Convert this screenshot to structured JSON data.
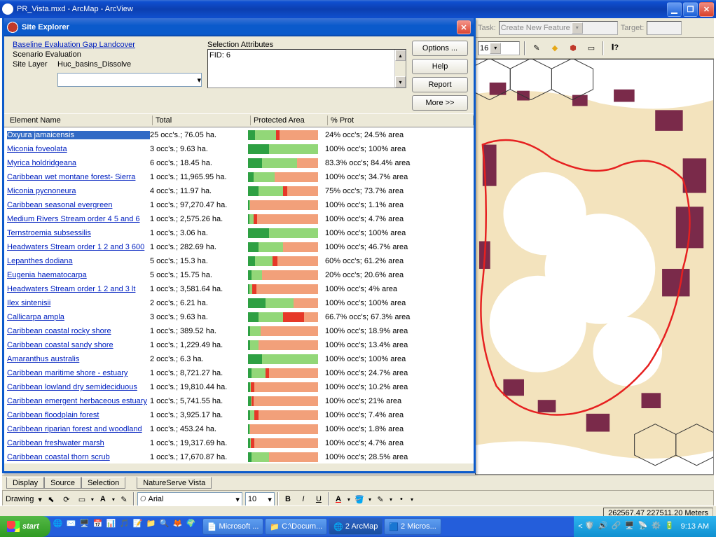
{
  "window": {
    "title": "PR_Vista.mxd - ArcMap - ArcView"
  },
  "toprow": {
    "task_label": "Task:",
    "task_value": "Create New Feature",
    "target_label": "Target:"
  },
  "secondrow": {
    "size_value": "16"
  },
  "dialog": {
    "title": "Site Explorer",
    "link1": "Baseline Evaluation Gap Landcover",
    "scenario": "Scenario Evaluation",
    "sitelayer_label": "Site Layer",
    "sitelayer_value": "Huc_basins_Dissolve",
    "attr_label": "Selection Attributes",
    "attr_text": "FID:  6",
    "btn_options": "Options ...",
    "btn_help": "Help",
    "btn_report": "Report",
    "btn_more": "More >>",
    "cols": {
      "name": "Element Name",
      "total": "Total",
      "pa": "Protected Area",
      "prot": "% Prot"
    },
    "rows": [
      {
        "name": "Oxyura jamaicensis",
        "total": "25 occ's.; 76.05 ha.",
        "prot": "24% occ's; 24.5% area",
        "sel": true,
        "bar": [
          10,
          30,
          5,
          55
        ]
      },
      {
        "name": "Miconia foveolata",
        "total": "3 occ's.; 9.63 ha.",
        "prot": "100% occ's; 100% area",
        "bar": [
          30,
          70,
          0,
          0
        ]
      },
      {
        "name": "Myrica holdridgeana",
        "total": "6 occ's.; 18.45 ha.",
        "prot": "83.3% occ's; 84.4% area",
        "bar": [
          20,
          50,
          0,
          30
        ]
      },
      {
        "name": "Caribbean wet montane forest- Sierra",
        "total": "1 occ's.; 11,965.95 ha.",
        "prot": "100% occ's; 34.7% area",
        "bar": [
          8,
          30,
          0,
          62
        ]
      },
      {
        "name": "Miconia pycnoneura",
        "total": "4 occ's.; 11.97 ha.",
        "prot": "75% occ's; 73.7% area",
        "bar": [
          15,
          35,
          6,
          44
        ]
      },
      {
        "name": "Caribbean seasonal evergreen",
        "total": "1 occ's.; 97,270.47 ha.",
        "prot": "100% occ's; 1.1% area",
        "bar": [
          2,
          1,
          0,
          97
        ]
      },
      {
        "name": "Medium Rivers Stream order 4 5 and 6",
        "total": "1 occ's.; 2,575.26 ha.",
        "prot": "100% occ's; 4.7% area",
        "bar": [
          2,
          6,
          5,
          87
        ]
      },
      {
        "name": "Ternstroemia subsessilis",
        "total": "1 occ's.; 3.06 ha.",
        "prot": "100% occ's; 100% area",
        "bar": [
          30,
          70,
          0,
          0
        ]
      },
      {
        "name": "Headwaters Stream order 1 2 and 3  600",
        "total": "1 occ's.; 282.69 ha.",
        "prot": "100% occ's; 46.7% area",
        "bar": [
          15,
          35,
          0,
          50
        ]
      },
      {
        "name": "Lepanthes dodiana",
        "total": "5 occ's.; 15.3 ha.",
        "prot": "60% occ's; 61.2% area",
        "bar": [
          10,
          25,
          7,
          58
        ]
      },
      {
        "name": "Eugenia haematocarpa",
        "total": "5 occ's.; 15.75 ha.",
        "prot": "20% occ's; 20.6% area",
        "bar": [
          5,
          15,
          0,
          80
        ]
      },
      {
        "name": "Headwaters Stream order 1 2 and 3 lt",
        "total": "1 occ's.; 3,581.64 ha.",
        "prot": "100% occ's; 4% area",
        "bar": [
          2,
          4,
          6,
          88
        ]
      },
      {
        "name": "Ilex sintenisii",
        "total": "2 occ's.; 6.21 ha.",
        "prot": "100% occ's; 100% area",
        "bar": [
          25,
          40,
          0,
          35
        ]
      },
      {
        "name": "Callicarpa ampla",
        "total": "3 occ's.; 9.63 ha.",
        "prot": "66.7% occ's; 67.3% area",
        "bar": [
          15,
          35,
          30,
          20
        ]
      },
      {
        "name": "Caribbean coastal rocky shore",
        "total": "1 occ's.; 389.52 ha.",
        "prot": "100% occ's; 18.9% area",
        "bar": [
          3,
          15,
          0,
          82
        ]
      },
      {
        "name": "Caribbean coastal sandy shore",
        "total": "1 occ's.; 1,229.49 ha.",
        "prot": "100% occ's; 13.4% area",
        "bar": [
          3,
          12,
          0,
          85
        ]
      },
      {
        "name": "Amaranthus australis",
        "total": "2 occ's.; 6.3 ha.",
        "prot": "100% occ's; 100% area",
        "bar": [
          20,
          80,
          0,
          0
        ]
      },
      {
        "name": "Caribbean maritime shore - estuary",
        "total": "1 occ's.; 8,721.27 ha.",
        "prot": "100% occ's; 24.7% area",
        "bar": [
          5,
          20,
          5,
          70
        ]
      },
      {
        "name": "Caribbean lowland dry semideciduous",
        "total": "1 occ's.; 19,810.44 ha.",
        "prot": "100% occ's; 10.2% area",
        "bar": [
          3,
          1,
          5,
          91
        ]
      },
      {
        "name": "Caribbean emergent herbaceous estuary",
        "total": "1 occ's.; 5,741.55 ha.",
        "prot": "100% occ's; 21% area",
        "bar": [
          4,
          1,
          3,
          92
        ]
      },
      {
        "name": "Caribbean floodplain forest",
        "total": "1 occ's.; 3,925.17 ha.",
        "prot": "100% occ's; 7.4% area",
        "bar": [
          3,
          6,
          6,
          85
        ]
      },
      {
        "name": "Caribbean riparian forest and woodland",
        "total": "1 occ's.; 453.24 ha.",
        "prot": "100% occ's; 1.8% area",
        "bar": [
          2,
          1,
          0,
          97
        ]
      },
      {
        "name": "Caribbean freshwater marsh",
        "total": "1 occ's.; 19,317.69 ha.",
        "prot": "100% occ's; 4.7% area",
        "bar": [
          3,
          1,
          5,
          91
        ]
      },
      {
        "name": "Caribbean coastal thorn scrub",
        "total": "1 occ's.; 17,670.87 ha.",
        "prot": "100% occ's; 28.5% area",
        "bar": [
          5,
          25,
          0,
          70
        ]
      }
    ]
  },
  "bottom_tabs": [
    "Display",
    "Source",
    "Selection",
    "NatureServe Vista"
  ],
  "drawbar": {
    "label": "Drawing",
    "font": "Arial",
    "size": "10"
  },
  "status": {
    "coords": "262567.47 227511.20 Meters"
  },
  "taskbar": {
    "start": "start",
    "items": [
      {
        "icon": "📄",
        "label": "Microsoft ..."
      },
      {
        "icon": "📁",
        "label": "C:\\Docum..."
      },
      {
        "icon": "🌐",
        "label": "2 ArcMap",
        "active": true
      },
      {
        "icon": "🟦",
        "label": "2 Micros..."
      }
    ],
    "clock": "9:13 AM"
  }
}
